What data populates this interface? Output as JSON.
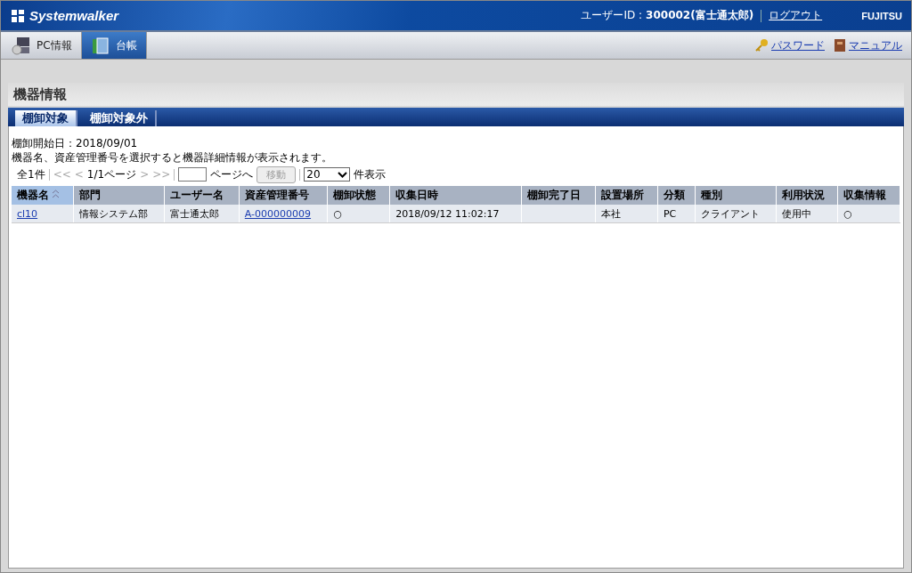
{
  "header": {
    "logo": "Systemwalker",
    "user_label": "ユーザーID :",
    "user_value": "300002(富士通太郎)",
    "logout": "ログアウト",
    "brand": "FUJITSU"
  },
  "nav": {
    "tabs": [
      {
        "label": "PC情報",
        "selected": false,
        "kind": "pc"
      },
      {
        "label": "台帳",
        "selected": true,
        "kind": "ledger"
      }
    ],
    "links": [
      {
        "label": "パスワード",
        "kind": "key"
      },
      {
        "label": "マニュアル",
        "kind": "book"
      }
    ]
  },
  "page_title": "機器情報",
  "tabs": [
    {
      "label": "棚卸対象",
      "selected": true
    },
    {
      "label": "棚卸対象外",
      "selected": false
    }
  ],
  "start_date": "棚卸開始日：2018/09/01",
  "instruction": "機器名、資産管理番号を選択すると機器詳細情報が表示されます。",
  "pager": {
    "total": "全1件",
    "first": "<<",
    "prev": "<",
    "page": "1/1ページ",
    "next": ">",
    "last": ">>",
    "page_suffix": "ページへ",
    "move_button": {
      "label": "移動",
      "disabled": true
    },
    "per_page": "20",
    "per_page_suffix": "件表示"
  },
  "table": {
    "columns": [
      {
        "label": "機器名",
        "sorted": true
      },
      {
        "label": "部門",
        "sorted": false
      },
      {
        "label": "ユーザー名",
        "sorted": false
      },
      {
        "label": "資産管理番号",
        "sorted": false
      },
      {
        "label": "棚卸状態",
        "sorted": false
      },
      {
        "label": "収集日時",
        "sorted": false
      },
      {
        "label": "棚卸完了日",
        "sorted": false
      },
      {
        "label": "設置場所",
        "sorted": false
      },
      {
        "label": "分類",
        "sorted": false
      },
      {
        "label": "種別",
        "sorted": false
      },
      {
        "label": "利用状況",
        "sorted": false
      },
      {
        "label": "収集情報",
        "sorted": false
      }
    ],
    "rows": [
      {
        "cells": [
          {
            "kind": "link",
            "text": "cl10"
          },
          {
            "kind": "text",
            "text": "情報システム部"
          },
          {
            "kind": "text",
            "text": "富士通太郎"
          },
          {
            "kind": "link",
            "text": "A-000000009"
          },
          {
            "kind": "text",
            "text": "○"
          },
          {
            "kind": "text",
            "text": "2018/09/12 11:02:17"
          },
          {
            "kind": "empty"
          },
          {
            "kind": "text",
            "text": "本社"
          },
          {
            "kind": "text",
            "text": "PC"
          },
          {
            "kind": "text",
            "text": "クライアント"
          },
          {
            "kind": "text",
            "text": "使用中"
          },
          {
            "kind": "text",
            "text": "○"
          }
        ]
      }
    ]
  }
}
